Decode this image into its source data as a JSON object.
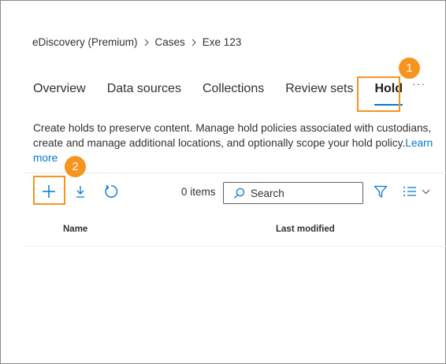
{
  "breadcrumb": {
    "items": [
      "eDiscovery (Premium)",
      "Cases",
      "Exe 123"
    ]
  },
  "tabs": [
    {
      "label": "Overview",
      "selected": false
    },
    {
      "label": "Data sources",
      "selected": false
    },
    {
      "label": "Collections",
      "selected": false
    },
    {
      "label": "Review sets",
      "selected": false
    },
    {
      "label": "Hold",
      "selected": true
    }
  ],
  "more_label": "···",
  "callouts": {
    "one": "1",
    "two": "2"
  },
  "description": {
    "text": "Create holds to preserve content. Manage hold policies associated with custodians, create and manage additional locations, and optionally scope your hold policy.",
    "link_text": "Learn more"
  },
  "toolbar": {
    "items_count": "0 items",
    "search_placeholder": "Search"
  },
  "table": {
    "columns": [
      "Name",
      "Last modified"
    ]
  },
  "colors": {
    "accent": "#0078d4",
    "callout": "#f7941d"
  }
}
